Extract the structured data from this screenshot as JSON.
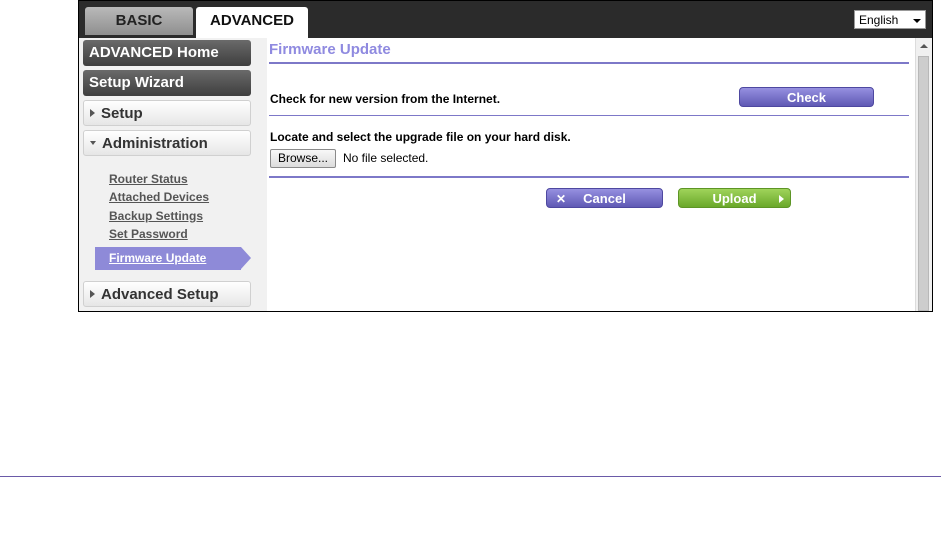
{
  "tabs": {
    "basic": "BASIC",
    "advanced": "ADVANCED"
  },
  "language": {
    "selected": "English"
  },
  "sidebar": {
    "advanced_home": "ADVANCED Home",
    "setup_wizard": "Setup Wizard",
    "setup": "Setup",
    "administration": "Administration",
    "admin_items": [
      "Router Status",
      "Attached Devices",
      "Backup Settings",
      "Set Password",
      "Firmware Update"
    ],
    "advanced_setup": "Advanced Setup"
  },
  "content": {
    "title": "Firmware Update",
    "check_label": "Check for new version from the Internet.",
    "check_button": "Check",
    "locate_label": "Locate and select the upgrade file on your hard disk.",
    "browse_button": "Browse...",
    "file_status": "No file selected.",
    "cancel_button": "Cancel",
    "upload_button": "Upload"
  },
  "colors": {
    "accent_purple": "#8e8ad8",
    "upload_green": "#7ab83a"
  }
}
